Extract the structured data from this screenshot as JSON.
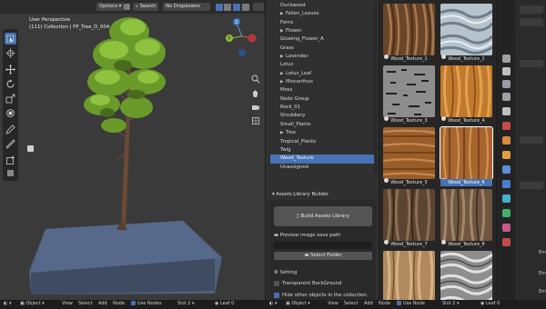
{
  "viewport": {
    "header": {
      "options": "Options",
      "search": "Search",
      "dropdowns": "No Dropdowns"
    },
    "overlay": {
      "perspective": "User Perspective",
      "collection": "(111) Collection | FP_Tree_D_004"
    }
  },
  "asset_list": {
    "items": [
      {
        "label": "Duckweed",
        "arrow": false
      },
      {
        "label": "Fallen_Leaves",
        "arrow": true
      },
      {
        "label": "Ferns",
        "arrow": false
      },
      {
        "label": "Flower",
        "arrow": true
      },
      {
        "label": "Glowing_Flower_A",
        "arrow": false
      },
      {
        "label": "Grass",
        "arrow": false
      },
      {
        "label": "Lavender",
        "arrow": true
      },
      {
        "label": "Lotus",
        "arrow": false
      },
      {
        "label": "Lotus_Leaf",
        "arrow": true
      },
      {
        "label": "Miscanthus",
        "arrow": true
      },
      {
        "label": "Moss",
        "arrow": false
      },
      {
        "label": "Node Group",
        "arrow": false
      },
      {
        "label": "Rock_01",
        "arrow": false
      },
      {
        "label": "Shrubbery",
        "arrow": false
      },
      {
        "label": "Small_Plants",
        "arrow": false
      },
      {
        "label": "Tree",
        "arrow": true
      },
      {
        "label": "Tropical_Plants",
        "arrow": false
      },
      {
        "label": "Twig",
        "arrow": false
      },
      {
        "label": "Wood_Texture",
        "arrow": false,
        "selected": true
      },
      {
        "label": "Unassigned",
        "arrow": false
      }
    ]
  },
  "builder": {
    "title": "Assets Library Builder",
    "build_label": "Build Assets Library",
    "preview_label": "Preview image save path",
    "select_folder": "Select Folder",
    "setting_label": "Setting",
    "transparent_label": "Transparent BackGround",
    "hide_label": "Hide other objects in the collection."
  },
  "thumbnails": [
    {
      "label": "Wood_Texture_1",
      "style": "wood-dark"
    },
    {
      "label": "Wood_Texture_2",
      "style": "ice"
    },
    {
      "label": "Wood_Texture_3",
      "style": "grey-bark"
    },
    {
      "label": "Wood_Texture_4",
      "style": "orange"
    },
    {
      "label": "Wood_Texture_5",
      "style": "plank"
    },
    {
      "label": "Wood_Texture_6",
      "style": "plank",
      "selected": true
    },
    {
      "label": "Wood_Texture_7",
      "style": "brown-bark"
    },
    {
      "label": "Wood_Texture_8",
      "style": "brown-bark2"
    },
    {
      "label": "",
      "style": "tan"
    },
    {
      "label": "",
      "style": "white-wave"
    }
  ],
  "statusbar": {
    "object": "Object",
    "view": "View",
    "select": "Select",
    "add": "Add",
    "node": "Node",
    "use_nodes": "Use Nodes",
    "slot": "Slot 2",
    "leaf": "Leaf",
    "leaf_count": "0",
    "object2": "Object",
    "view2": "View",
    "select2": "Select",
    "add2": "Add",
    "node2": "Node",
    "use_nodes2": "Use Node",
    "slot2": "Slot 2",
    "leaf2": "Leaf",
    "leaf_count2": "0"
  },
  "props_labels": [
    "Em",
    "Em",
    "Em"
  ],
  "colors": {
    "accent": "#4772b3",
    "panel": "#303030",
    "viewport": "#3a3a3a"
  }
}
